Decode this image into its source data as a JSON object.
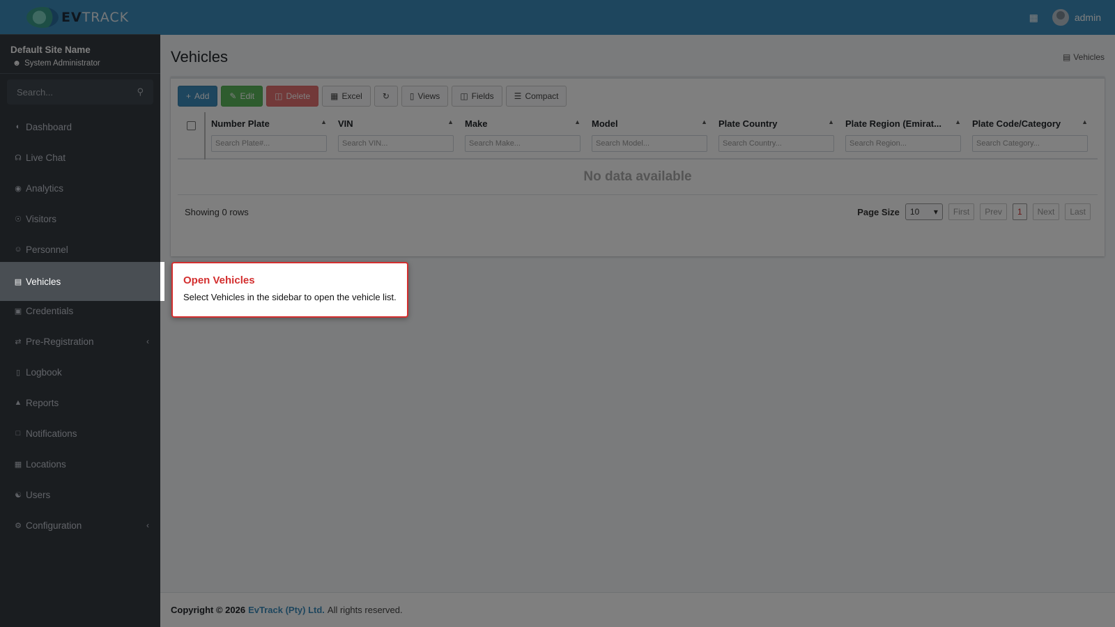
{
  "brand": {
    "strong": "EV",
    "light": "TRACK"
  },
  "site": {
    "name": "Default Site Name",
    "role": "System Administrator"
  },
  "sidebar": {
    "search_placeholder": "Search...",
    "items": [
      {
        "label": "Dashboard",
        "icon": "gauge-icon"
      },
      {
        "label": "Live Chat",
        "icon": "headset-icon"
      },
      {
        "label": "Analytics",
        "icon": "target-icon"
      },
      {
        "label": "Visitors",
        "icon": "eye-icon"
      },
      {
        "label": "Personnel",
        "icon": "users-icon"
      },
      {
        "label": "Vehicles",
        "icon": "car-icon"
      },
      {
        "label": "Credentials",
        "icon": "id-card-icon"
      },
      {
        "label": "Pre-Registration",
        "icon": "exchange-icon"
      },
      {
        "label": "Logbook",
        "icon": "book-icon"
      },
      {
        "label": "Reports",
        "icon": "chart-icon"
      },
      {
        "label": "Notifications",
        "icon": "chat-icon"
      },
      {
        "label": "Locations",
        "icon": "building-icon"
      },
      {
        "label": "Users",
        "icon": "user-gear-icon"
      },
      {
        "label": "Configuration",
        "icon": "gear-icon"
      }
    ]
  },
  "topbar": {
    "user": "admin"
  },
  "page": {
    "title": "Vehicles",
    "breadcrumb": "Vehicles"
  },
  "toolbar": {
    "add": "Add",
    "edit": "Edit",
    "delete": "Delete",
    "excel": "Excel",
    "views": "Views",
    "fields": "Fields",
    "compact": "Compact"
  },
  "table": {
    "columns": [
      {
        "title": "Number Plate",
        "placeholder": "Search Plate#..."
      },
      {
        "title": "VIN",
        "placeholder": "Search VIN..."
      },
      {
        "title": "Make",
        "placeholder": "Search Make..."
      },
      {
        "title": "Model",
        "placeholder": "Search Model..."
      },
      {
        "title": "Plate Country",
        "placeholder": "Search Country..."
      },
      {
        "title": "Plate Region (Emirat...",
        "placeholder": "Search Region..."
      },
      {
        "title": "Plate Code/Category",
        "placeholder": "Search Category..."
      }
    ],
    "empty": "No data available",
    "showing": "Showing 0 rows"
  },
  "pager": {
    "label": "Page Size",
    "size": "10",
    "first": "First",
    "prev": "Prev",
    "current": "1",
    "next": "Next",
    "last": "Last"
  },
  "tooltip": {
    "title": "Open Vehicles",
    "body": "Select Vehicles in the sidebar to open the vehicle list."
  },
  "footer": {
    "copyright": "Copyright © 2026",
    "company": "EvTrack (Pty) Ltd.",
    "rights": "All rights reserved."
  }
}
